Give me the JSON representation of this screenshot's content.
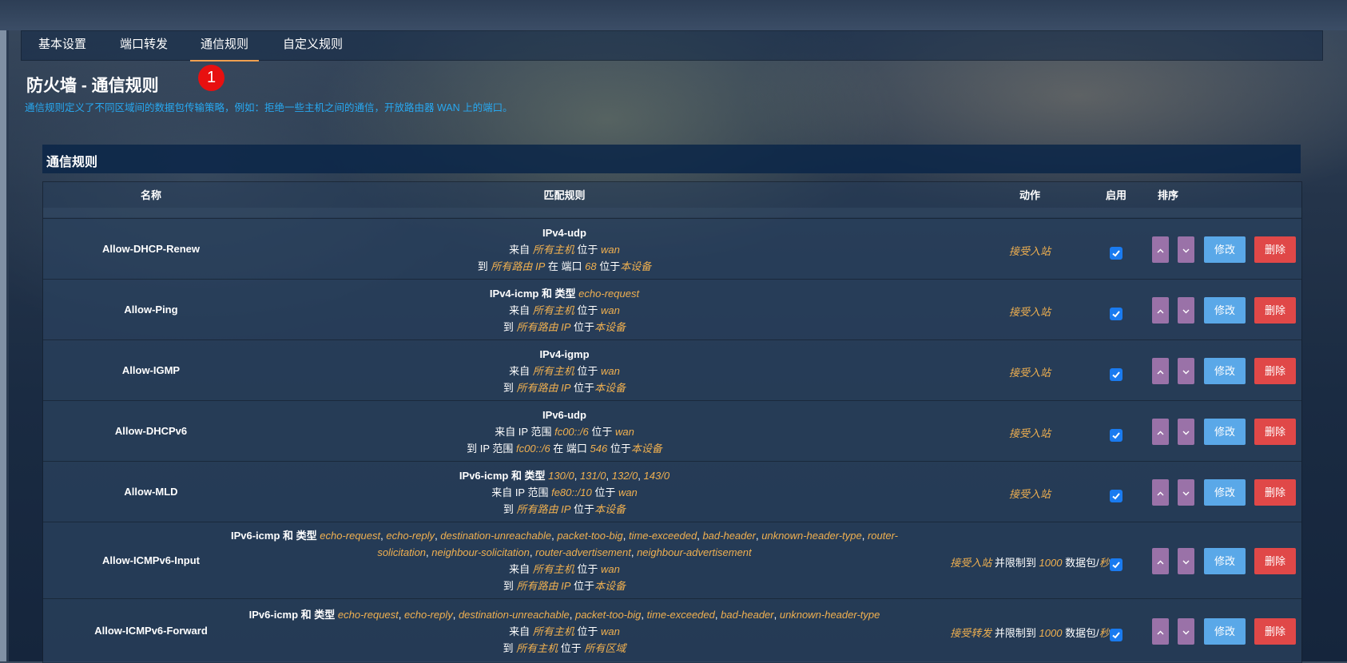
{
  "tabs": [
    {
      "label": "基本设置"
    },
    {
      "label": "端口转发"
    },
    {
      "label": "通信规则"
    },
    {
      "label": "自定义规则"
    }
  ],
  "badge": "1",
  "page": {
    "title": "防火墙 - 通信规则",
    "description": "通信规则定义了不同区域间的数据包传输策略，例如：拒绝一些主机之间的通信，开放路由器 WAN 上的端口。"
  },
  "section": {
    "title": "通信规则"
  },
  "table": {
    "headers": {
      "name": "名称",
      "match": "匹配规则",
      "action": "动作",
      "enable": "启用",
      "sort": "排序"
    },
    "buttons": {
      "edit": "修改",
      "delete": "删除"
    },
    "rows": [
      {
        "name": "Allow-DHCP-Renew",
        "enabled": true,
        "match": [
          [
            {
              "t": "IPv4-udp",
              "b": true
            }
          ],
          [
            {
              "t": "来自 "
            },
            {
              "t": "所有主机",
              "e": true
            },
            {
              "t": " 位于 "
            },
            {
              "t": "wan",
              "e": true
            }
          ],
          [
            {
              "t": "到 "
            },
            {
              "t": "所有路由 IP",
              "e": true
            },
            {
              "t": " 在 端口 "
            },
            {
              "t": "68",
              "e": true
            },
            {
              "t": " 位于"
            },
            {
              "t": "本设备",
              "e": true
            }
          ]
        ],
        "action": [
          {
            "t": "接受入站",
            "e": true
          }
        ]
      },
      {
        "name": "Allow-Ping",
        "enabled": true,
        "match": [
          [
            {
              "t": "IPv4-icmp 和 类型 ",
              "b": true
            },
            {
              "t": "echo-request",
              "e": true
            }
          ],
          [
            {
              "t": "来自 "
            },
            {
              "t": "所有主机",
              "e": true
            },
            {
              "t": " 位于 "
            },
            {
              "t": "wan",
              "e": true
            }
          ],
          [
            {
              "t": "到 "
            },
            {
              "t": "所有路由 IP",
              "e": true
            },
            {
              "t": " 位于"
            },
            {
              "t": "本设备",
              "e": true
            }
          ]
        ],
        "action": [
          {
            "t": "接受入站",
            "e": true
          }
        ]
      },
      {
        "name": "Allow-IGMP",
        "enabled": true,
        "match": [
          [
            {
              "t": "IPv4-igmp",
              "b": true
            }
          ],
          [
            {
              "t": "来自 "
            },
            {
              "t": "所有主机",
              "e": true
            },
            {
              "t": " 位于 "
            },
            {
              "t": "wan",
              "e": true
            }
          ],
          [
            {
              "t": "到 "
            },
            {
              "t": "所有路由 IP",
              "e": true
            },
            {
              "t": " 位于"
            },
            {
              "t": "本设备",
              "e": true
            }
          ]
        ],
        "action": [
          {
            "t": "接受入站",
            "e": true
          }
        ]
      },
      {
        "name": "Allow-DHCPv6",
        "enabled": true,
        "match": [
          [
            {
              "t": "IPv6-udp",
              "b": true
            }
          ],
          [
            {
              "t": "来自 IP 范围 "
            },
            {
              "t": "fc00::/6",
              "e": true
            },
            {
              "t": " 位于 "
            },
            {
              "t": "wan",
              "e": true
            }
          ],
          [
            {
              "t": "到 IP 范围 "
            },
            {
              "t": "fc00::/6",
              "e": true
            },
            {
              "t": " 在 端口 "
            },
            {
              "t": "546",
              "e": true
            },
            {
              "t": " 位于"
            },
            {
              "t": "本设备",
              "e": true
            }
          ]
        ],
        "action": [
          {
            "t": "接受入站",
            "e": true
          }
        ]
      },
      {
        "name": "Allow-MLD",
        "enabled": true,
        "match": [
          [
            {
              "t": "IPv6-icmp 和 类型 ",
              "b": true
            },
            {
              "t": "130/0",
              "e": true
            },
            {
              "t": ", "
            },
            {
              "t": "131/0",
              "e": true
            },
            {
              "t": ", "
            },
            {
              "t": "132/0",
              "e": true
            },
            {
              "t": ", "
            },
            {
              "t": "143/0",
              "e": true
            }
          ],
          [
            {
              "t": "来自 IP 范围 "
            },
            {
              "t": "fe80::/10",
              "e": true
            },
            {
              "t": " 位于 "
            },
            {
              "t": "wan",
              "e": true
            }
          ],
          [
            {
              "t": "到 "
            },
            {
              "t": "所有路由 IP",
              "e": true
            },
            {
              "t": " 位于"
            },
            {
              "t": "本设备",
              "e": true
            }
          ]
        ],
        "action": [
          {
            "t": "接受入站",
            "e": true
          }
        ]
      },
      {
        "name": "Allow-ICMPv6-Input",
        "enabled": true,
        "match": [
          [
            {
              "t": "IPv6-icmp 和 类型 ",
              "b": true
            },
            {
              "t": "echo-request",
              "e": true
            },
            {
              "t": ", "
            },
            {
              "t": "echo-reply",
              "e": true
            },
            {
              "t": ", "
            },
            {
              "t": "destination-unreachable",
              "e": true
            },
            {
              "t": ", "
            },
            {
              "t": "packet-too-big",
              "e": true
            },
            {
              "t": ", "
            },
            {
              "t": "time-exceeded",
              "e": true
            },
            {
              "t": ", "
            },
            {
              "t": "bad-header",
              "e": true
            },
            {
              "t": ", "
            },
            {
              "t": "unknown-header-type",
              "e": true
            },
            {
              "t": ", "
            },
            {
              "t": "router-",
              "e": true
            }
          ],
          [
            {
              "t": "solicitation",
              "e": true
            },
            {
              "t": ", "
            },
            {
              "t": "neighbour-solicitation",
              "e": true
            },
            {
              "t": ", "
            },
            {
              "t": "router-advertisement",
              "e": true
            },
            {
              "t": ", "
            },
            {
              "t": "neighbour-advertisement",
              "e": true
            }
          ],
          [
            {
              "t": "来自 "
            },
            {
              "t": "所有主机",
              "e": true
            },
            {
              "t": " 位于 "
            },
            {
              "t": "wan",
              "e": true
            }
          ],
          [
            {
              "t": "到 "
            },
            {
              "t": "所有路由 IP",
              "e": true
            },
            {
              "t": " 位于"
            },
            {
              "t": "本设备",
              "e": true
            }
          ]
        ],
        "action": [
          {
            "t": "接受入站",
            "e": true
          },
          {
            "t": " 并限制到 "
          },
          {
            "t": "1000",
            "e": true
          },
          {
            "t": " 数据包/"
          },
          {
            "t": "秒",
            "e": true
          }
        ]
      },
      {
        "name": "Allow-ICMPv6-Forward",
        "enabled": true,
        "match": [
          [
            {
              "t": "IPv6-icmp 和 类型 ",
              "b": true
            },
            {
              "t": "echo-request",
              "e": true
            },
            {
              "t": ", "
            },
            {
              "t": "echo-reply",
              "e": true
            },
            {
              "t": ", "
            },
            {
              "t": "destination-unreachable",
              "e": true
            },
            {
              "t": ", "
            },
            {
              "t": "packet-too-big",
              "e": true
            },
            {
              "t": ", "
            },
            {
              "t": "time-exceeded",
              "e": true
            },
            {
              "t": ", "
            },
            {
              "t": "bad-header",
              "e": true
            },
            {
              "t": ", "
            },
            {
              "t": "unknown-header-type",
              "e": true
            }
          ],
          [
            {
              "t": "来自 "
            },
            {
              "t": "所有主机",
              "e": true
            },
            {
              "t": " 位于 "
            },
            {
              "t": "wan",
              "e": true
            }
          ],
          [
            {
              "t": "到 "
            },
            {
              "t": "所有主机",
              "e": true
            },
            {
              "t": " 位于 "
            },
            {
              "t": "所有区域",
              "e": true
            }
          ]
        ],
        "action": [
          {
            "t": "接受转发",
            "e": true
          },
          {
            "t": " 并限制到 "
          },
          {
            "t": "1000",
            "e": true
          },
          {
            "t": " 数据包/"
          },
          {
            "t": "秒",
            "e": true
          }
        ]
      }
    ]
  }
}
